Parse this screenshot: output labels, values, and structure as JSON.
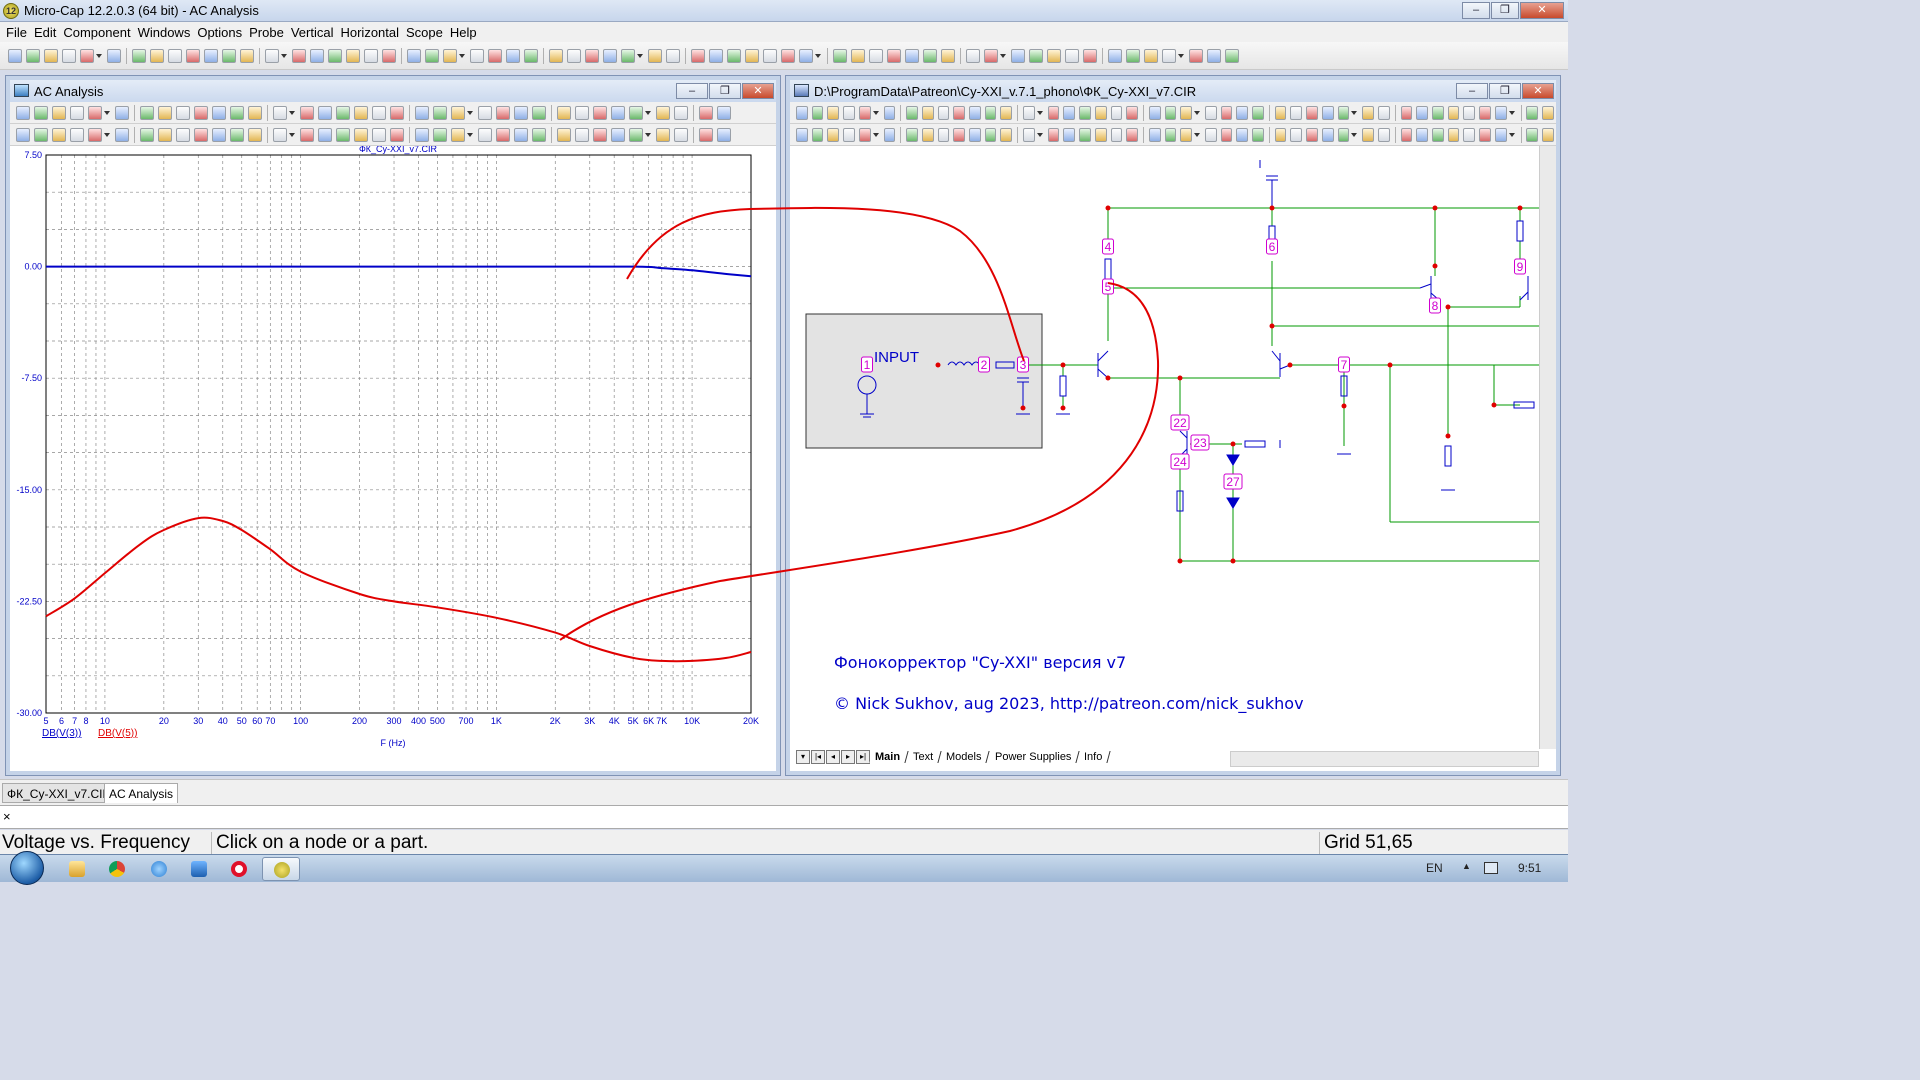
{
  "app": {
    "title": "Micro-Cap 12.2.0.3 (64 bit) - AC Analysis",
    "icon_label": "12",
    "buttons": [
      "–",
      "❐",
      "✕"
    ]
  },
  "menu": [
    "File",
    "Edit",
    "Component",
    "Windows",
    "Options",
    "Probe",
    "Vertical",
    "Horizontal",
    "Scope",
    "Help"
  ],
  "ac_window": {
    "title": "AC Analysis",
    "buttons": [
      "–",
      "❐",
      "✕"
    ],
    "plot_title": "ФК_Cy-XXI_v7.CIR",
    "xlabel": "F (Hz)",
    "legend": [
      "DB(V(3))",
      "DB(V(5))"
    ]
  },
  "chart_data": {
    "type": "line",
    "title": "ФК_Cy-XXI_v7.CIR",
    "xlabel": "F (Hz)",
    "ylabel": "",
    "xscale": "log",
    "xlim": [
      5,
      20000
    ],
    "ylim": [
      -30,
      7.5
    ],
    "yticks": [
      "7.50",
      "0.00",
      "-7.50",
      "-15.00",
      "-22.50",
      "-30.00"
    ],
    "xticks": [
      "5",
      "6",
      "7",
      "8",
      "10",
      "20",
      "30",
      "40",
      "50",
      "60",
      "70",
      "100",
      "200",
      "300",
      "400",
      "500",
      "700",
      "1K",
      "2K",
      "3K",
      "4K",
      "5K",
      "6K",
      "7K",
      "10K",
      "20K"
    ],
    "xtick_values": [
      5,
      6,
      7,
      8,
      10,
      20,
      30,
      40,
      50,
      60,
      70,
      100,
      200,
      300,
      400,
      500,
      700,
      1000,
      2000,
      3000,
      4000,
      5000,
      6000,
      7000,
      10000,
      20000
    ],
    "grid": true,
    "series": [
      {
        "name": "DB(V(3))",
        "color": "#0000c8",
        "x": [
          5,
          100,
          1000,
          5000,
          7000,
          10000,
          15000,
          20000
        ],
        "y": [
          0.0,
          0.0,
          0.0,
          0.0,
          -0.1,
          -0.25,
          -0.5,
          -0.65
        ]
      },
      {
        "name": "DB(V(5))",
        "color": "#e00000",
        "x": [
          5,
          7,
          10,
          15,
          20,
          30,
          40,
          50,
          70,
          100,
          200,
          300,
          500,
          1000,
          2000,
          3000,
          5000,
          7000,
          10000,
          15000,
          20000
        ],
        "y": [
          -23.5,
          -22.3,
          -20.6,
          -18.7,
          -17.7,
          -16.9,
          -17.1,
          -17.7,
          -19.0,
          -20.5,
          -22.0,
          -22.5,
          -22.9,
          -23.6,
          -24.6,
          -25.5,
          -26.3,
          -26.5,
          -26.5,
          -26.3,
          -25.9
        ]
      }
    ]
  },
  "schematic_window": {
    "title": "D:\\ProgramData\\Patreon\\Cy-XXI_v.7.1_phono\\ФК_Cy-XXI_v7.CIR",
    "buttons": [
      "–",
      "❐",
      "✕"
    ],
    "input_label": "INPUT",
    "node_labels": [
      "1",
      "2",
      "3",
      "4",
      "5",
      "6",
      "7",
      "8",
      "9",
      "22",
      "23",
      "24",
      "27"
    ],
    "caption_line1": "Фонокорректор \"Cy-XXI\" версия v7",
    "caption_line2": "© Nick Sukhov, aug 2023, http://patreon.com/nick_sukhov",
    "tabs": [
      "Main",
      "Text",
      "Models",
      "Power Supplies",
      "Info"
    ],
    "nav": [
      "▾",
      "|◂",
      "◂",
      "▸",
      "▸|"
    ]
  },
  "doc_tabs": [
    "ФК_Cy-XXI_v7.CIR",
    "AC Analysis"
  ],
  "input_bar": {
    "close": "×"
  },
  "status": {
    "mode": "Voltage vs. Frequency",
    "hint": "Click on a node or a part.",
    "grid": "Grid 51,65"
  },
  "taskbar": {
    "lang": "EN",
    "time": "9:51"
  }
}
